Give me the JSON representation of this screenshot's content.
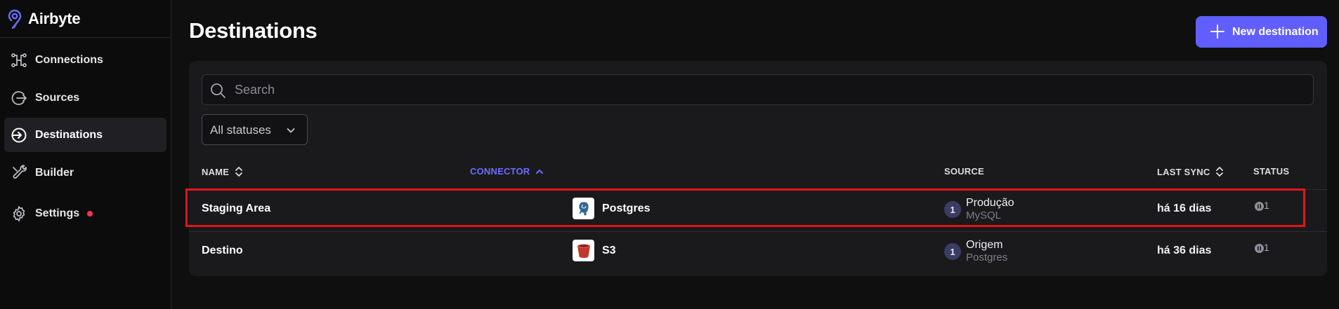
{
  "brand": {
    "name": "Airbyte"
  },
  "sidebar": {
    "items": [
      {
        "label": "Connections",
        "icon": "connections-icon"
      },
      {
        "label": "Sources",
        "icon": "sources-icon"
      },
      {
        "label": "Destinations",
        "icon": "destinations-icon",
        "active": true
      },
      {
        "label": "Builder",
        "icon": "builder-icon"
      },
      {
        "label": "Settings",
        "icon": "gear-icon",
        "badge": "alert-dot"
      }
    ]
  },
  "page": {
    "title": "Destinations",
    "new_button_label": "New destination"
  },
  "search": {
    "placeholder": "Search",
    "value": ""
  },
  "filter": {
    "selected": "All statuses"
  },
  "table": {
    "headers": {
      "name": "NAME",
      "connector": "CONNECTOR",
      "source": "SOURCE",
      "last_sync": "LAST SYNC",
      "status": "STATUS"
    },
    "sort": {
      "column": "connector",
      "direction": "ascending"
    },
    "rows": [
      {
        "name": "Staging Area",
        "connector": "Postgres",
        "connector_icon": "postgres-icon",
        "source_count": "1",
        "source_name": "Produção",
        "source_type": "MySQL",
        "last_sync": "há 16 dias",
        "status_count": "1",
        "highlighted": true
      },
      {
        "name": "Destino",
        "connector": "S3",
        "connector_icon": "s3-bucket-icon",
        "source_count": "1",
        "source_name": "Origem",
        "source_type": "Postgres",
        "last_sync": "há 36 dias",
        "status_count": "1",
        "highlighted": false
      }
    ]
  },
  "colors": {
    "accent": "#615eff",
    "background": "#0f0f10",
    "card": "#1a1a1d",
    "highlight_border": "#e0161d",
    "alert_dot": "#ff3358"
  }
}
